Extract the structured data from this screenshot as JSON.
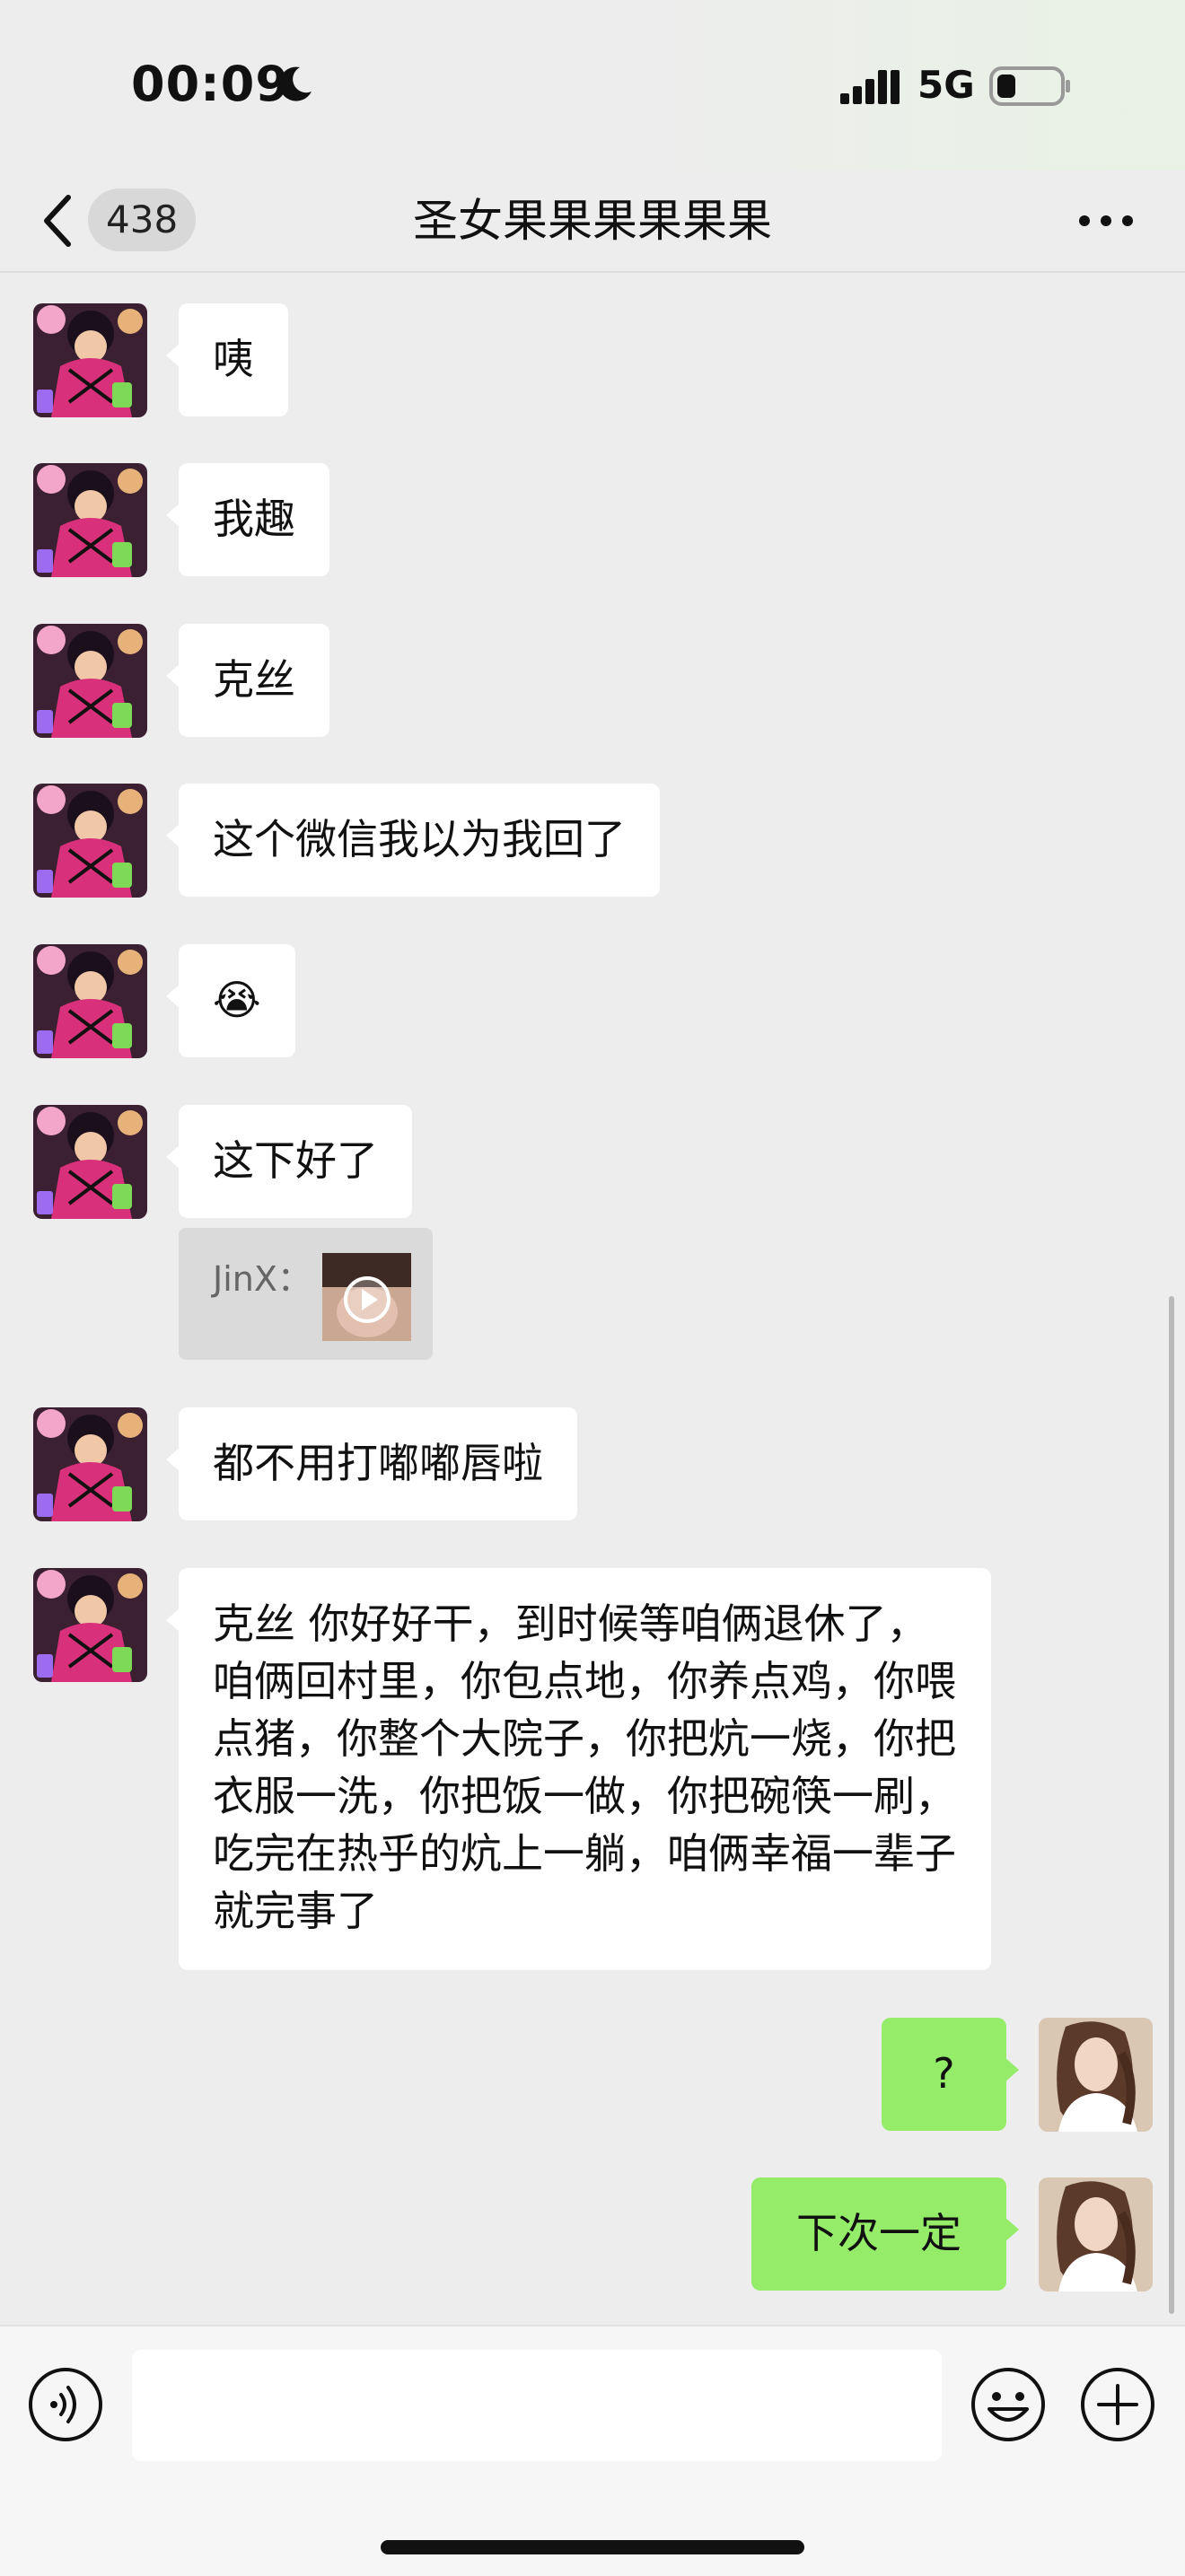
{
  "status_bar": {
    "time": "00:09",
    "network": "5G"
  },
  "nav": {
    "unread_count": "438",
    "title": "圣女果果果果果果"
  },
  "messages": [
    {
      "side": "left",
      "text": "咦"
    },
    {
      "side": "left",
      "text": "我趣"
    },
    {
      "side": "left",
      "text": "克丝"
    },
    {
      "side": "left",
      "text": "这个微信我以为我回了"
    },
    {
      "side": "left",
      "text": "😭"
    },
    {
      "side": "left",
      "text": "这下好了"
    },
    {
      "side": "left",
      "text": "都不用打嘟嘟唇啦"
    },
    {
      "side": "left",
      "text": "克丝 你好好干，到时候等咱俩退休了，咱俩回村里，你包点地，你养点鸡，你喂点猪，你整个大院子，你把炕一烧，你把衣服一洗，你把饭一做，你把碗筷一刷，吃完在热乎的炕上一躺，咱俩幸福一辈子就完事了"
    },
    {
      "side": "right",
      "text": "?"
    },
    {
      "side": "right",
      "text": "下次一定"
    }
  ],
  "quote": {
    "sender": "JinX："
  },
  "input": {
    "placeholder": ""
  },
  "colors": {
    "background": "#ededed",
    "incoming_bubble": "#ffffff",
    "outgoing_bubble": "#95ec69"
  }
}
